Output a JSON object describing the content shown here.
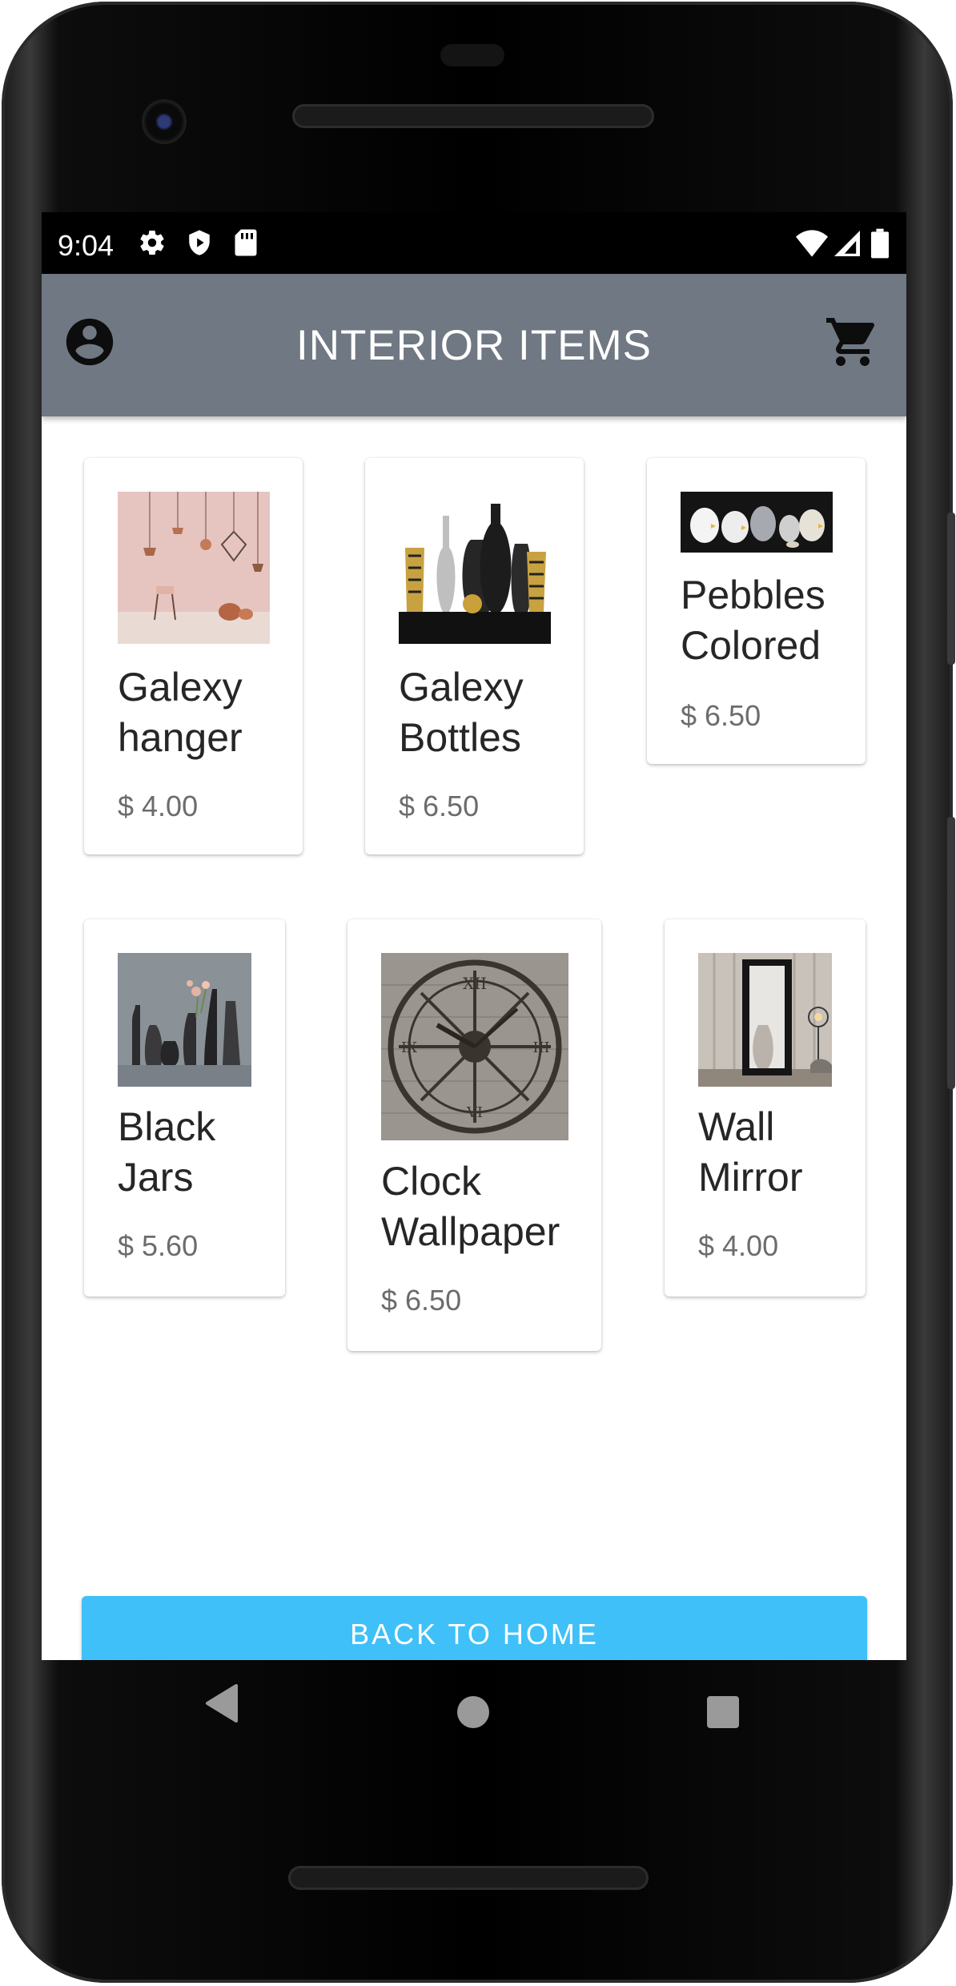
{
  "status_bar": {
    "time": "9:04",
    "left_icons": [
      "gear-icon",
      "shield-icon",
      "sd-card-icon"
    ],
    "right_icons": [
      "wifi-icon",
      "signal-icon",
      "battery-icon"
    ]
  },
  "app_bar": {
    "title": "INTERIOR ITEMS",
    "left_icon": "account-circle-icon",
    "right_icon": "cart-icon",
    "background_color": "#6f7883"
  },
  "products": [
    {
      "name": "Galexy\nhanger",
      "price": "$ 4.00",
      "image": "pendant-lamps-image"
    },
    {
      "name": "Galexy\nBottles",
      "price": "$ 6.50",
      "image": "bottles-image"
    },
    {
      "name": "Pebbles\nColored",
      "price": "$ 6.50",
      "image": "pebbles-image"
    },
    {
      "name": "Black\nJars",
      "price": "$ 5.60",
      "image": "black-jars-image"
    },
    {
      "name": "Clock\nWallpaper",
      "price": "$ 6.50",
      "image": "clock-image"
    },
    {
      "name": "Wall\nMirror",
      "price": "$ 4.00",
      "image": "wall-mirror-image"
    }
  ],
  "home_button": {
    "label": "BACK TO HOME",
    "color": "#3fc0f8"
  },
  "nav_bar": {
    "buttons": [
      "back-icon",
      "home-icon",
      "recents-icon"
    ]
  }
}
